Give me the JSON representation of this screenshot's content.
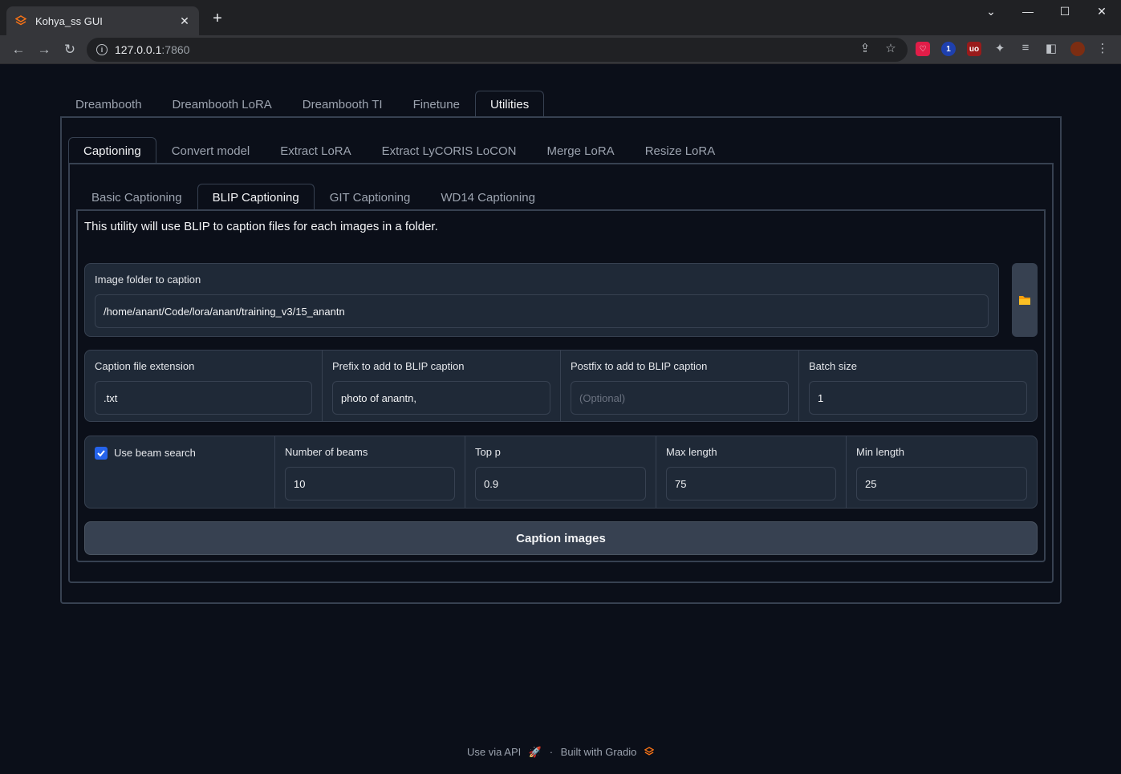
{
  "browser": {
    "tab_title": "Kohya_ss GUI",
    "url_host": "127.0.0.1",
    "url_port": ":7860"
  },
  "main_tabs": [
    "Dreambooth",
    "Dreambooth LoRA",
    "Dreambooth TI",
    "Finetune",
    "Utilities"
  ],
  "utility_tabs": [
    "Captioning",
    "Convert model",
    "Extract LoRA",
    "Extract LyCORIS LoCON",
    "Merge LoRA",
    "Resize LoRA"
  ],
  "caption_tabs": [
    "Basic Captioning",
    "BLIP Captioning",
    "GIT Captioning",
    "WD14 Captioning"
  ],
  "description": "This utility will use BLIP to caption files for each images in a folder.",
  "folder": {
    "label": "Image folder to caption",
    "value": "/home/anant/Code/lora/anant/training_v3/15_anantn"
  },
  "fields1": {
    "ext_label": "Caption file extension",
    "ext_value": ".txt",
    "prefix_label": "Prefix to add to BLIP caption",
    "prefix_value": "photo of anantn,",
    "postfix_label": "Postfix to add to BLIP caption",
    "postfix_placeholder": "(Optional)",
    "batch_label": "Batch size",
    "batch_value": "1"
  },
  "fields2": {
    "beam_label": "Use beam search",
    "beam_checked": true,
    "num_beams_label": "Number of beams",
    "num_beams_value": "10",
    "top_p_label": "Top p",
    "top_p_value": "0.9",
    "max_len_label": "Max length",
    "max_len_value": "75",
    "min_len_label": "Min length",
    "min_len_value": "25"
  },
  "run_button": "Caption images",
  "footer": {
    "api": "Use via API",
    "sep": "·",
    "built": "Built with Gradio"
  },
  "colors": {
    "background": "#0b0f19",
    "block": "#1f2937",
    "border": "#374151",
    "accent": "#2563eb",
    "folder_icon": "#f59e0b"
  }
}
